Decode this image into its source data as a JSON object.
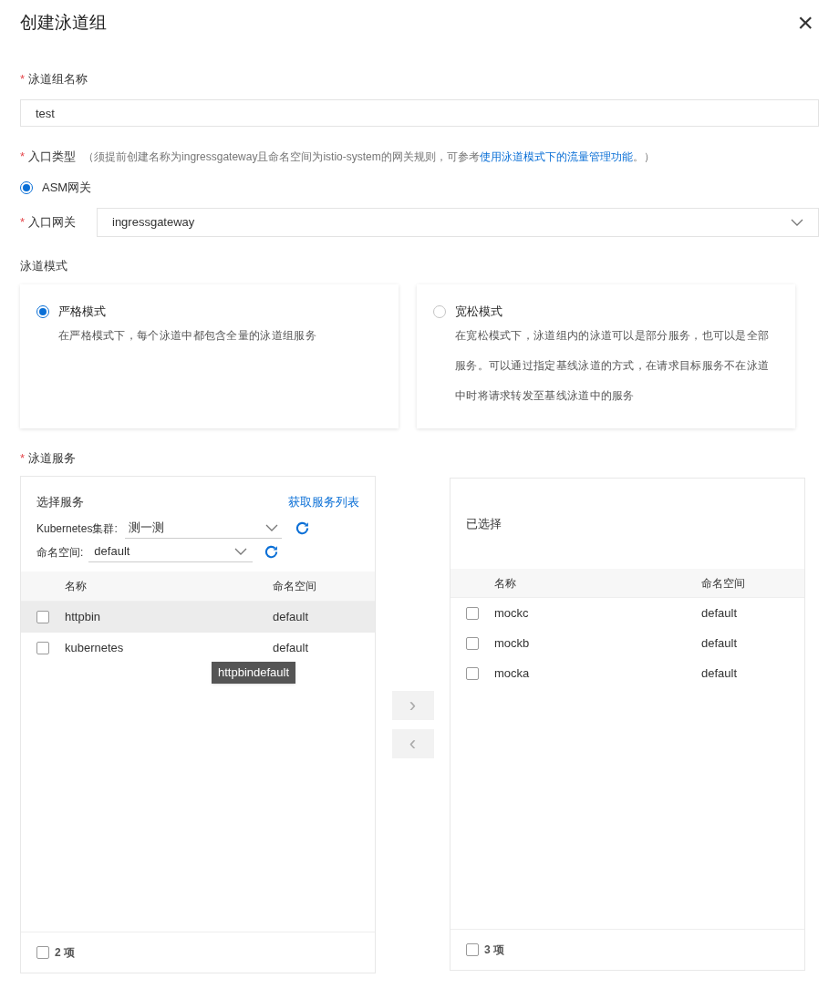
{
  "dialog": {
    "title": "创建泳道组",
    "close": "×"
  },
  "name_field": {
    "label": "泳道组名称",
    "required_mark": "*",
    "value": "test"
  },
  "entry_type": {
    "label": "入口类型",
    "required_mark": "*",
    "hint_before": "（须提前创建名称为ingressgateway且命名空间为istio-system的网关规则，可参考",
    "hint_link": "使用泳道模式下的流量管理功能",
    "hint_after": "。）",
    "options": [
      {
        "label": "ASM网关",
        "selected": true
      }
    ]
  },
  "gateway": {
    "label": "入口网关",
    "required_mark": "*",
    "value": "ingressgateway"
  },
  "mode": {
    "label": "泳道模式",
    "options": [
      {
        "title": "严格模式",
        "selected": true,
        "description": "在严格模式下，每个泳道中都包含全量的泳道组服务"
      },
      {
        "title": "宽松模式",
        "selected": false,
        "description": "在宽松模式下，泳道组内的泳道可以是部分服务，也可以是全部服务。可以通过指定基线泳道的方式，在请求目标服务不在泳道中时将请求转发至基线泳道中的服务"
      }
    ]
  },
  "services": {
    "label": "泳道服务",
    "required_mark": "*",
    "source": {
      "title": "选择服务",
      "fetch_link": "获取服务列表",
      "cluster_label": "Kubernetes集群:",
      "cluster_value": "测一测",
      "namespace_label": "命名空间:",
      "namespace_value": "default",
      "columns": [
        "名称",
        "命名空间"
      ],
      "rows": [
        {
          "name": "httpbin",
          "namespace": "default",
          "checked": false,
          "highlighted": true
        },
        {
          "name": "kubernetes",
          "namespace": "default",
          "checked": false,
          "highlighted": false
        }
      ],
      "tooltip": "httpbindefault",
      "footer": {
        "checked": false,
        "count": "2 项"
      }
    },
    "transfer": {
      "right": "›",
      "left": "‹"
    },
    "target": {
      "title": "已选择",
      "columns": [
        "名称",
        "命名空间"
      ],
      "rows": [
        {
          "name": "mockc",
          "namespace": "default",
          "checked": false
        },
        {
          "name": "mockb",
          "namespace": "default",
          "checked": false
        },
        {
          "name": "mocka",
          "namespace": "default",
          "checked": false
        }
      ],
      "footer": {
        "checked": false,
        "count": "3 项"
      }
    }
  }
}
